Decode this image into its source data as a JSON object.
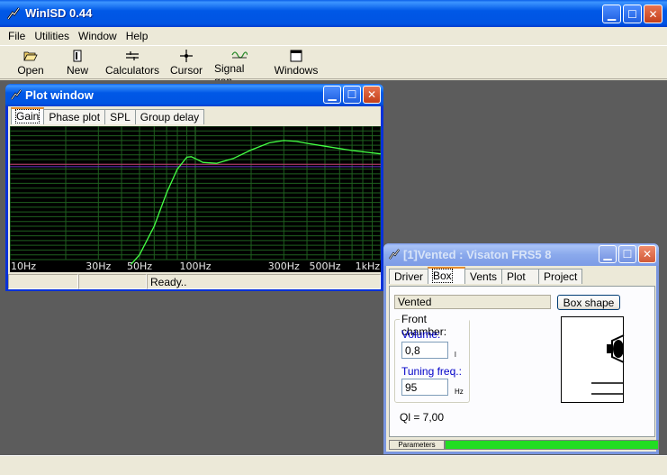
{
  "app": {
    "title": "WinISD 0.44"
  },
  "menu": {
    "items": [
      "File",
      "Utilities",
      "Window",
      "Help"
    ]
  },
  "toolbar": {
    "buttons": [
      {
        "label": "Open",
        "icon": "folder-open-icon"
      },
      {
        "label": "New",
        "icon": "new-document-icon"
      },
      {
        "label": "Calculators",
        "icon": "calculator-icon"
      },
      {
        "label": "Cursor",
        "icon": "crosshair-icon"
      },
      {
        "label": "Signal gen.",
        "icon": "sine-wave-icon"
      },
      {
        "label": "Windows",
        "icon": "window-icon"
      }
    ]
  },
  "plot_window": {
    "title": "Plot window",
    "tabs": [
      "Gain",
      "Phase plot",
      "SPL",
      "Group delay"
    ],
    "active_tab": "Gain",
    "status": [
      "",
      "",
      "Ready.."
    ],
    "x_labels": [
      "10Hz",
      "30Hz",
      "50Hz",
      "100Hz",
      "300Hz",
      "500Hz",
      "1kHz"
    ]
  },
  "chart_data": {
    "type": "line",
    "x_scale": "log",
    "xlim": [
      10,
      1000
    ],
    "ylim": [
      -20,
      8
    ],
    "grid": true,
    "x_tick_labels": [
      "10Hz",
      "30Hz",
      "50Hz",
      "100Hz",
      "300Hz",
      "500Hz",
      "1kHz"
    ],
    "reference_lines": [
      {
        "color": "#c83270",
        "y": 0
      },
      {
        "color": "#6a35c8",
        "y": -0.5
      }
    ],
    "series": [
      {
        "color": "#44ff44",
        "x": [
          45,
          50,
          60,
          70,
          80,
          90,
          95,
          100,
          110,
          130,
          160,
          200,
          250,
          300,
          350,
          400,
          500,
          700,
          1000
        ],
        "y": [
          -21,
          -19,
          -13,
          -6,
          -1,
          1.5,
          1.6,
          1.2,
          0.4,
          0.2,
          1.2,
          3.0,
          4.5,
          5.0,
          4.8,
          4.4,
          3.8,
          2.9,
          2.2
        ]
      }
    ]
  },
  "vented_window": {
    "title": "[1]Vented : Visaton FRS5 8",
    "tabs": [
      "Driver",
      "Box",
      "Vents",
      "Plot",
      "Project"
    ],
    "active_tab": "Box",
    "box_type": "Vented",
    "box_shape_button": "Box shape",
    "front_chamber_label": "Front chamber:",
    "volume_label": "Volume:",
    "volume_value": "0,8",
    "volume_unit": "l",
    "tuning_label": "Tuning freq.:",
    "tuning_value": "95",
    "tuning_unit": "Hz",
    "ql_text": "Ql = 7,00",
    "progress_label": "Parameters",
    "progress_value": 1.0
  }
}
